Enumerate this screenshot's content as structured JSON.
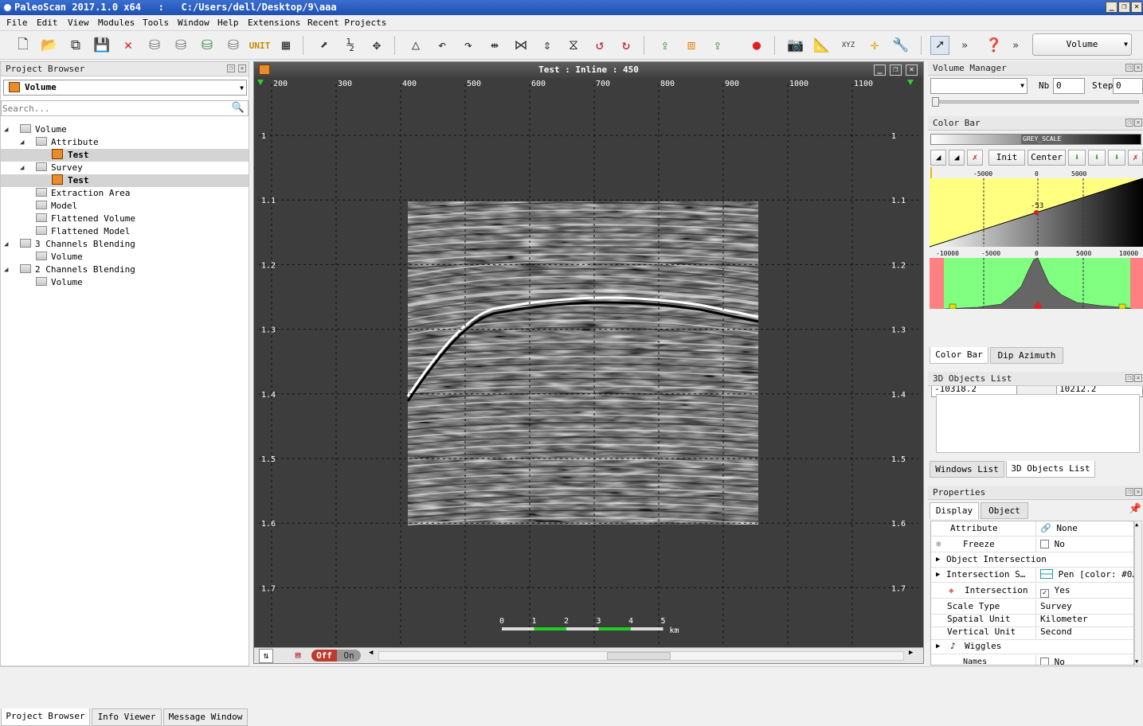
{
  "app": {
    "title": "PaleoScan 2017.1.0 x64   :   C:/Users/dell/Desktop/9\\aaa"
  },
  "menu": [
    "File",
    "Edit",
    "View",
    "Modules",
    "Tools",
    "Window",
    "Help",
    "Extensions",
    "Recent Projects"
  ],
  "toolbar": {
    "volume_combo": "Volume"
  },
  "project_browser": {
    "title": "Project Browser",
    "combo": "Volume",
    "search_placeholder": "Search...",
    "tree": [
      {
        "label": "Volume",
        "level": 0,
        "type": "folder",
        "expanded": true
      },
      {
        "label": "Attribute",
        "level": 1,
        "type": "folder",
        "expanded": true
      },
      {
        "label": "Test",
        "level": 2,
        "type": "cube",
        "selected": true
      },
      {
        "label": "Survey",
        "level": 1,
        "type": "folder",
        "expanded": true
      },
      {
        "label": "Test",
        "level": 2,
        "type": "cube",
        "selected": true
      },
      {
        "label": "Extraction Area",
        "level": 1,
        "type": "folder"
      },
      {
        "label": "Model",
        "level": 1,
        "type": "folder"
      },
      {
        "label": "Flattened Volume",
        "level": 1,
        "type": "folder"
      },
      {
        "label": "Flattened Model",
        "level": 1,
        "type": "folder"
      },
      {
        "label": "3 Channels Blending",
        "level": 0,
        "type": "folder",
        "expanded": true
      },
      {
        "label": "Volume",
        "level": 1,
        "type": "folder"
      },
      {
        "label": "2 Channels Blending",
        "level": 0,
        "type": "folder",
        "expanded": true
      },
      {
        "label": "Volume",
        "level": 1,
        "type": "folder"
      }
    ],
    "bottom_tabs": [
      "Project Browser",
      "Info Viewer",
      "Message Window"
    ]
  },
  "viewer": {
    "title": "Test : Inline : 450",
    "x_ticks": [
      "200",
      "300",
      "400",
      "500",
      "600",
      "700",
      "800",
      "900",
      "1000",
      "1100"
    ],
    "y_ticks": [
      "1",
      "1.1",
      "1.2",
      "1.3",
      "1.4",
      "1.5",
      "1.6",
      "1.7"
    ],
    "scale_ticks": [
      "0",
      "1",
      "2",
      "3",
      "4",
      "5"
    ],
    "scale_unit": "km",
    "toggle_off": "Off",
    "toggle_on": "On"
  },
  "volume_manager": {
    "title": "Volume Manager",
    "nb_label": "Nb",
    "nb_value": "0",
    "step_label": "Step",
    "step_value": "0"
  },
  "color_bar": {
    "title": "Color Bar",
    "scale_name": "GREY_SCALE",
    "init_label": "Init",
    "center_label": "Center",
    "top_ticks": [
      "-5000",
      "0",
      "5000"
    ],
    "marker_value": "-53",
    "hist_ticks": [
      "-10000",
      "-5000",
      "0",
      "5000",
      "10000"
    ],
    "min_value": "-10318.2",
    "max_value": "10212.2",
    "tabs": [
      "Color Bar",
      "Dip Azimuth"
    ],
    "colors": {
      "yellow": "#ffff80",
      "green": "#80ff80",
      "red": "#ff8080"
    }
  },
  "objects_list": {
    "title": "3D Objects List",
    "tabs": [
      "Windows List",
      "3D Objects List"
    ]
  },
  "properties": {
    "title": "Properties",
    "tabs": [
      "Display",
      "Object"
    ],
    "rows": [
      {
        "key": "Attribute",
        "value": "None"
      },
      {
        "key": "Freeze",
        "value": "No"
      },
      {
        "key": "Object Intersection",
        "value": ""
      },
      {
        "key": "Intersection S…",
        "value": "Pen [color: #0…"
      },
      {
        "key": "Intersection",
        "value": "Yes"
      },
      {
        "key": "Scale Type",
        "value": "Survey"
      },
      {
        "key": "Spatial Unit",
        "value": "Kilometer"
      },
      {
        "key": "Vertical Unit",
        "value": "Second"
      },
      {
        "key": "Wiggles",
        "value": ""
      },
      {
        "key": "Names",
        "value": "No"
      }
    ]
  }
}
